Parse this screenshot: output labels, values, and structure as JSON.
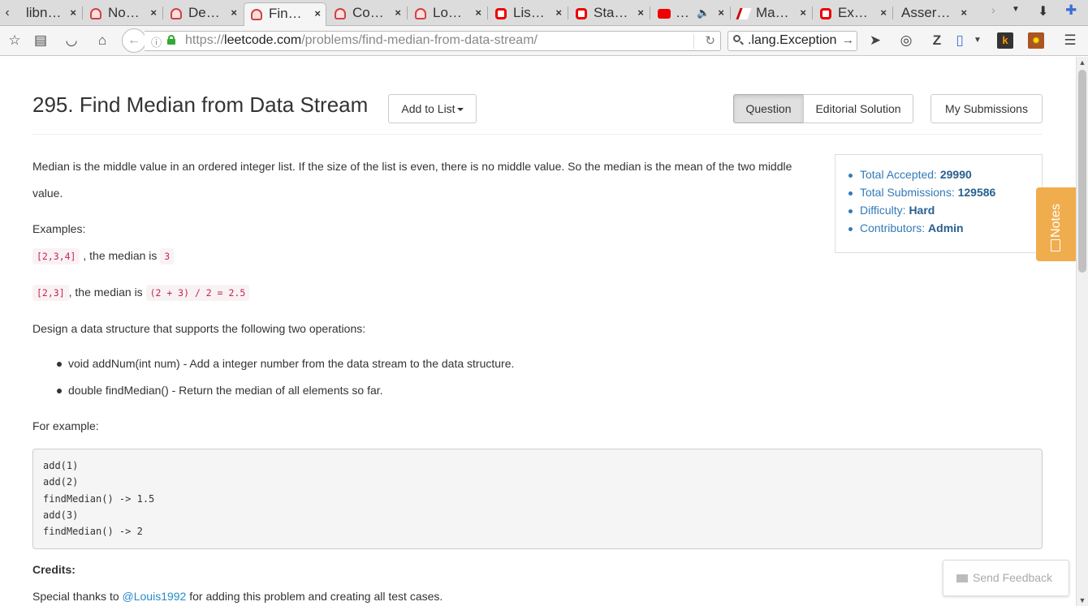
{
  "browser": {
    "tabs": [
      {
        "title": "libn…",
        "icon": "leetcode-icon",
        "active": false
      },
      {
        "title": "No…",
        "icon": "leetcode-icon",
        "active": false
      },
      {
        "title": "De…",
        "icon": "leetcode-icon",
        "active": false
      },
      {
        "title": "Fin…",
        "icon": "leetcode-icon",
        "active": true
      },
      {
        "title": "Co…",
        "icon": "leetcode-icon",
        "active": false
      },
      {
        "title": "Lo…",
        "icon": "leetcode-icon",
        "active": false
      },
      {
        "title": "Lis…",
        "icon": "oracle-icon",
        "active": false
      },
      {
        "title": "Sta…",
        "icon": "oracle-icon",
        "active": false
      },
      {
        "title": "…",
        "icon": "youtube-icon",
        "active": false
      },
      {
        "title": "Ma…",
        "icon": "pen-icon",
        "active": false
      },
      {
        "title": "Ex…",
        "icon": "oracle-icon",
        "active": false
      },
      {
        "title": "Asser…",
        "icon": "none",
        "active": false
      }
    ],
    "close_glyph": "×",
    "url_scheme": "https://",
    "url_host": "leetcode.com",
    "url_path": "/problems/find-median-from-data-stream/",
    "search_value": ".lang.Exception"
  },
  "problem": {
    "title": "295. Find Median from Data Stream",
    "add_to_list": "Add to List",
    "tabs": [
      "Question",
      "Editorial Solution"
    ],
    "my_submissions": "My Submissions",
    "intro": "Median is the middle value in an ordered integer list. If the size of the list is even, there is no middle value. So the median is the mean of the two middle value.",
    "examples_label": "Examples:",
    "example1_code": "[2,3,4]",
    "example1_text": " , the median is ",
    "example1_result": "3",
    "example2_code": "[2,3]",
    "example2_text": ", the median is ",
    "example2_result": "(2 + 3) / 2 = 2.5",
    "design_text": "Design a data structure that supports the following two operations:",
    "operations": [
      "void addNum(int num) - Add a integer number from the data stream to the data structure.",
      "double findMedian() - Return the median of all elements so far."
    ],
    "for_example": "For example:",
    "code_lines": [
      "add(1)",
      "add(2)",
      "findMedian() -> 1.5",
      "add(3)",
      "findMedian() -> 2"
    ],
    "credits_heading": "Credits:",
    "credits_prefix": "Special thanks to ",
    "credits_link": "@Louis1992",
    "credits_suffix": " for adding this problem and creating all test cases."
  },
  "stats": {
    "accepted_label": "Total Accepted: ",
    "accepted_value": "29990",
    "submissions_label": "Total Submissions: ",
    "submissions_value": "129586",
    "difficulty_label": "Difficulty: ",
    "difficulty_value": "Hard",
    "contributors_label": "Contributors: ",
    "contributors_value": "Admin"
  },
  "notes_label": "Notes",
  "feedback_label": "Send Feedback",
  "colors": {
    "link": "#2a8bc8",
    "stat_text": "#337ab7",
    "notes_bg": "#f0ad4e",
    "code_red": "#c7254e"
  }
}
